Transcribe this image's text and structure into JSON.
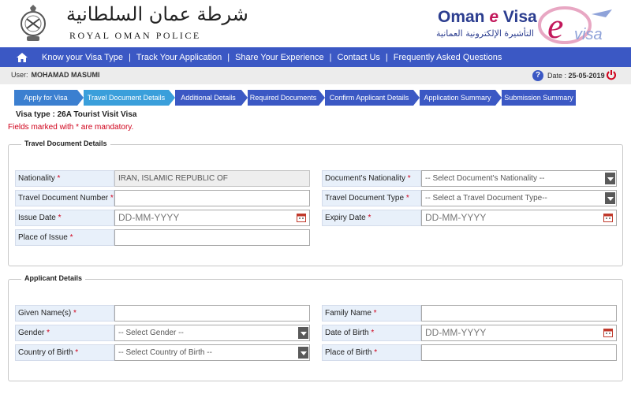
{
  "header": {
    "rop_arabic": "شرطة عمان السلطانية",
    "rop_english": "ROYAL OMAN POLICE",
    "evisa_oman": "Oman ",
    "evisa_e": "e",
    "evisa_visa": " Visa",
    "evisa_arabic": "التأشيرة الإلكترونية العمانية",
    "logo_text": "visa"
  },
  "nav": {
    "items": [
      {
        "label": "Know your Visa Type"
      },
      {
        "label": "Track Your Application"
      },
      {
        "label": "Share Your Experience"
      },
      {
        "label": "Contact Us"
      },
      {
        "label": "Frequently Asked Questions"
      }
    ],
    "separator": "|"
  },
  "userbar": {
    "user_label": "User:",
    "user_name": "MOHAMAD  MASUMI",
    "help": "?",
    "date_text": "Date :",
    "date_value": "25-05-2019"
  },
  "steps": [
    {
      "label": "Apply for Visa"
    },
    {
      "label": "Travel Document Details"
    },
    {
      "label": "Additional Details"
    },
    {
      "label": "Required Documents"
    },
    {
      "label": "Confirm Applicant Details"
    },
    {
      "label": "Application Summary"
    },
    {
      "label": "Submission Summary"
    }
  ],
  "visa_type": "Visa type  : 26A Tourist Visit Visa",
  "mandatory_note": "Fields marked with * are mandatory.",
  "travel_doc": {
    "legend": "Travel Document Details",
    "nationality_label": "Nationality",
    "nationality_value": "IRAN, ISLAMIC REPUBLIC OF",
    "doc_nationality_label": "Document's Nationality",
    "doc_nationality_value": "-- Select Document's Nationality --",
    "doc_number_label": "Travel Document Number",
    "doc_type_label": "Travel Document Type",
    "doc_type_value": "-- Select a Travel Document Type--",
    "issue_date_label": "Issue Date",
    "issue_date_placeholder": "DD-MM-YYYY",
    "expiry_date_label": "Expiry Date",
    "expiry_date_placeholder": "DD-MM-YYYY",
    "place_issue_label": "Place of Issue"
  },
  "applicant": {
    "legend": "Applicant Details",
    "given_name_label": "Given Name(s)",
    "family_name_label": "Family Name",
    "gender_label": "Gender",
    "gender_value": "-- Select Gender --",
    "dob_label": "Date of Birth",
    "dob_placeholder": "DD-MM-YYYY",
    "country_birth_label": "Country of Birth",
    "country_birth_value": "-- Select Country of Birth --",
    "place_birth_label": "Place of Birth"
  },
  "req_mark": " *",
  "colors": {
    "nav": "#3b58c4",
    "step_active": "#3a9fdb",
    "required": "#d0021b"
  }
}
